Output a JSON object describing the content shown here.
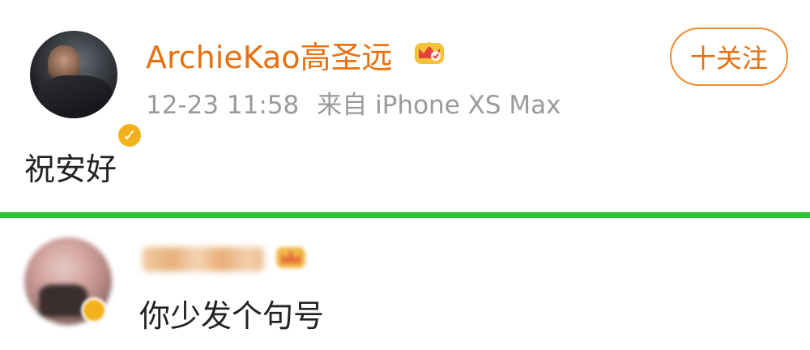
{
  "post": {
    "username": "ArchieKao高圣远",
    "timestamp": "12-23 11:58",
    "source": "来自 iPhone XS Max",
    "follow_label": "十关注",
    "text": "祝安好",
    "verified_icon": "verified-badge-icon",
    "vip_icon": "crown-badge-icon"
  },
  "comment": {
    "text": "你少发个句号",
    "avatar_blurred": true,
    "name_blurred": true
  },
  "colors": {
    "username": "#e8700f",
    "meta": "#9a9a9a",
    "follow_border": "#f08a2c",
    "divider": "#2bc23a",
    "verified": "#f3b21c"
  }
}
